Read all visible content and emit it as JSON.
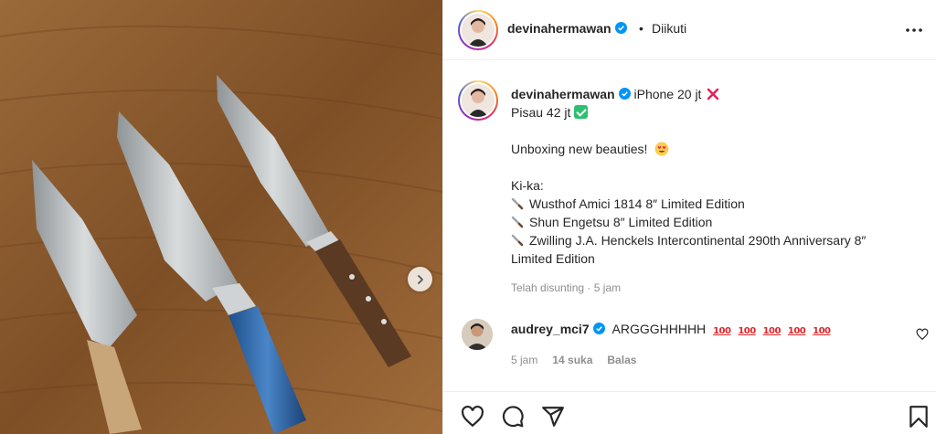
{
  "post": {
    "image_alt_icon": "carousel-next-icon"
  },
  "header": {
    "username": "devinahermawan",
    "dot": "•",
    "follow_status": "Diikuti",
    "more_icon": "more-options-icon"
  },
  "caption": {
    "username": "devinahermawan",
    "line1": "iPhone 20 jt",
    "line2": "Pisau 42 jt",
    "line3": "Unboxing new beauties!",
    "line4": "Ki-ka:",
    "items": [
      "Wusthof Amici 1814 8″ Limited Edition",
      "Shun Engetsu 8″ Limited Edition",
      "Zwilling J.A. Henckels Intercontinental 290th Anniversary 8″"
    ],
    "line_last": "Limited Edition",
    "time": "Telah disunting · 5 jam"
  },
  "comment": {
    "username": "audrey_mci7",
    "text": "ARGGGHHHHH",
    "emojis": [
      "100",
      "100",
      "100",
      "100",
      "100"
    ],
    "time": "5 jam",
    "likes": "14 suka",
    "reply": "Balas"
  },
  "actions": {
    "icons": [
      "heart-icon",
      "comment-icon",
      "share-icon",
      "bookmark-icon"
    ]
  },
  "colors": {
    "verified": "#0095f6",
    "muted": "#8e8e8e",
    "text": "#262626",
    "border": "#efefef"
  }
}
